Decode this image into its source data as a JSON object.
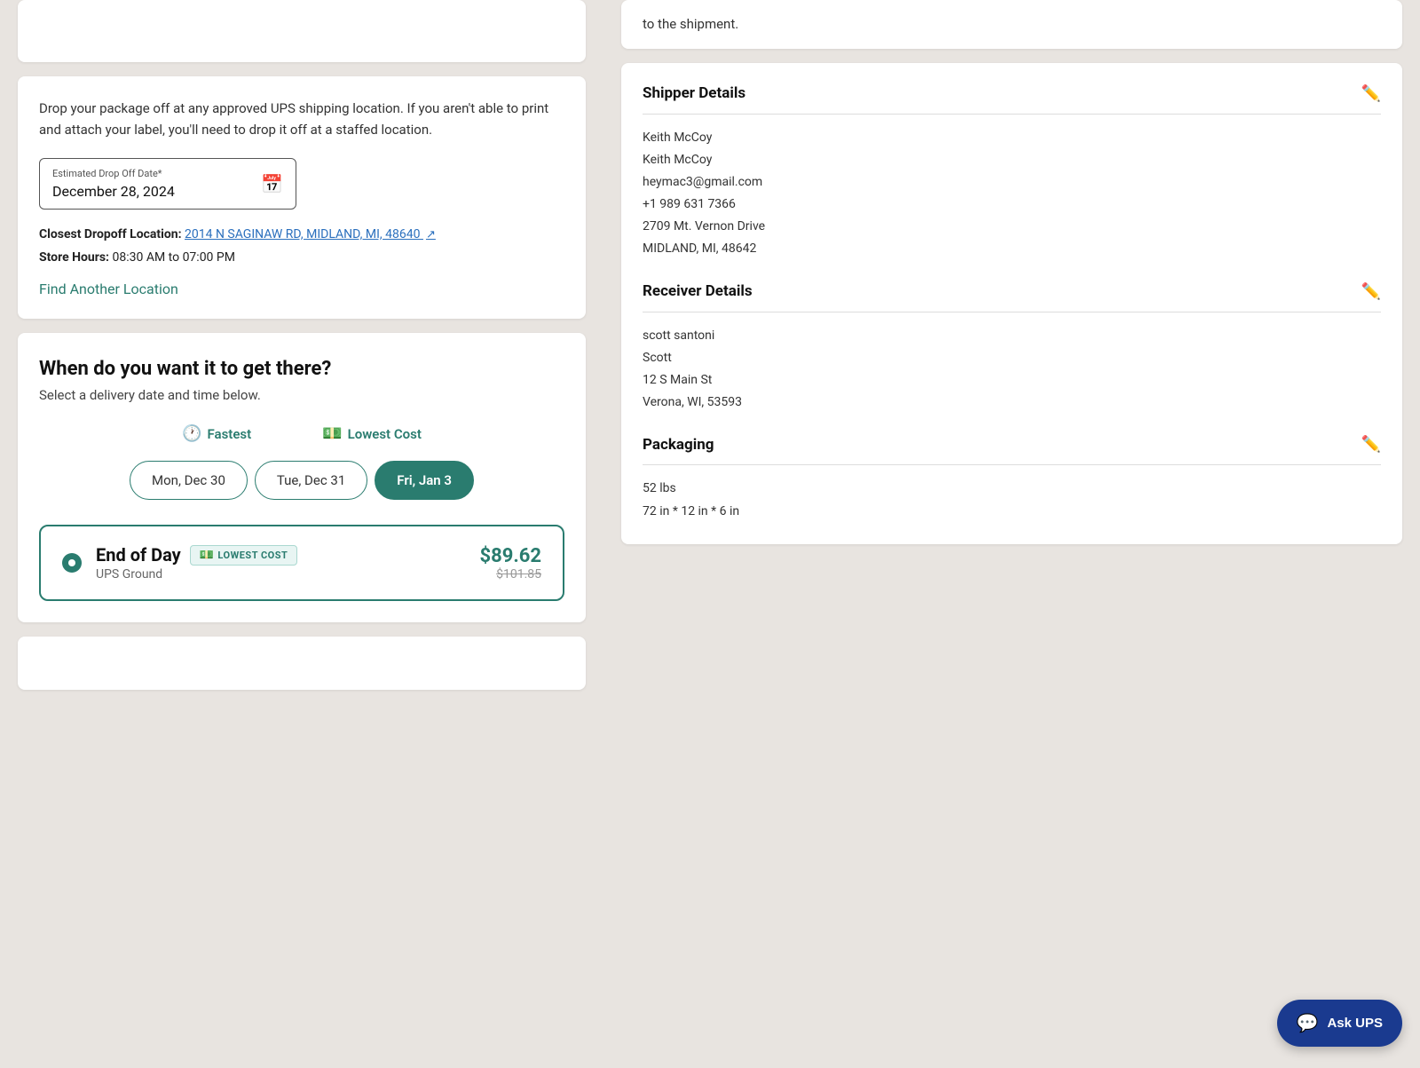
{
  "left": {
    "top_partial": {
      "visible": true
    },
    "dropoff_card": {
      "description": "Drop your package off at any approved UPS shipping location. If you aren't able to print and attach your label, you'll need to drop it off at a staffed location.",
      "date_label": "Estimated Drop Off Date*",
      "date_value": "December 28, 2024",
      "closest_label": "Closest Dropoff Location:",
      "closest_address": "2014 N SAGINAW RD, MIDLAND, MI, 48640",
      "store_hours_label": "Store Hours:",
      "store_hours_value": "08:30 AM to 07:00 PM",
      "find_another_label": "Find Another Location"
    },
    "delivery_card": {
      "title": "When do you want it to get there?",
      "subtitle": "Select a delivery date and time below.",
      "fastest_label": "Fastest",
      "lowest_cost_label": "Lowest Cost",
      "dates": [
        {
          "label": "Mon, Dec 30",
          "active": false
        },
        {
          "label": "Tue, Dec 31",
          "active": false
        },
        {
          "label": "Fri, Jan 3",
          "active": true
        }
      ],
      "service": {
        "name": "End of Day",
        "badge_label": "LOWEST COST",
        "type": "UPS Ground",
        "current_price": "$89.62",
        "original_price": "$101.85"
      }
    },
    "bottom_partial": {
      "visible": true
    }
  },
  "right": {
    "top_partial_text": "to the shipment.",
    "details_card": {
      "shipper": {
        "section_title": "Shipper Details",
        "name1": "Keith McCoy",
        "name2": "Keith McCoy",
        "email": "heymac3@gmail.com",
        "phone": "+1 989 631 7366",
        "address1": "2709 Mt. Vernon Drive",
        "address2": "MIDLAND, MI, 48642"
      },
      "receiver": {
        "section_title": "Receiver Details",
        "name1": "scott santoni",
        "name2": "Scott",
        "address1": "12 S Main St",
        "address2": "Verona, WI, 53593"
      },
      "packaging": {
        "section_title": "Packaging",
        "weight": "52 lbs",
        "dimensions": "72 in * 12 in * 6 in"
      }
    }
  },
  "ask_ups": {
    "label": "Ask UPS"
  }
}
